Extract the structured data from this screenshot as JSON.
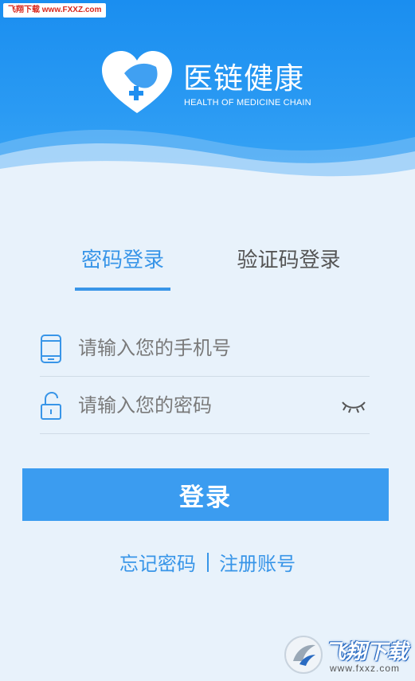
{
  "watermark_top": "飞翔下载 www.FXXZ.com",
  "brand": {
    "name": "医链健康",
    "subtitle": "HEALTH OF MEDICINE CHAIN"
  },
  "tabs": [
    {
      "label": "密码登录",
      "active": true
    },
    {
      "label": "验证码登录",
      "active": false
    }
  ],
  "form": {
    "phone_placeholder": "请输入您的手机号",
    "phone_icon": "phone-icon",
    "password_placeholder": "请输入您的密码",
    "password_icon": "lock-icon",
    "toggle_icon": "eye-closed-icon"
  },
  "login_button": "登录",
  "links": {
    "forgot": "忘记密码",
    "register": "注册账号"
  },
  "watermark_bottom": {
    "title": "飞翔下载",
    "url": "www.fxxz.com"
  },
  "colors": {
    "header": "#1a8ef0",
    "accent": "#3895e8",
    "button": "#3b9cf0",
    "background": "#e8f2fb"
  }
}
